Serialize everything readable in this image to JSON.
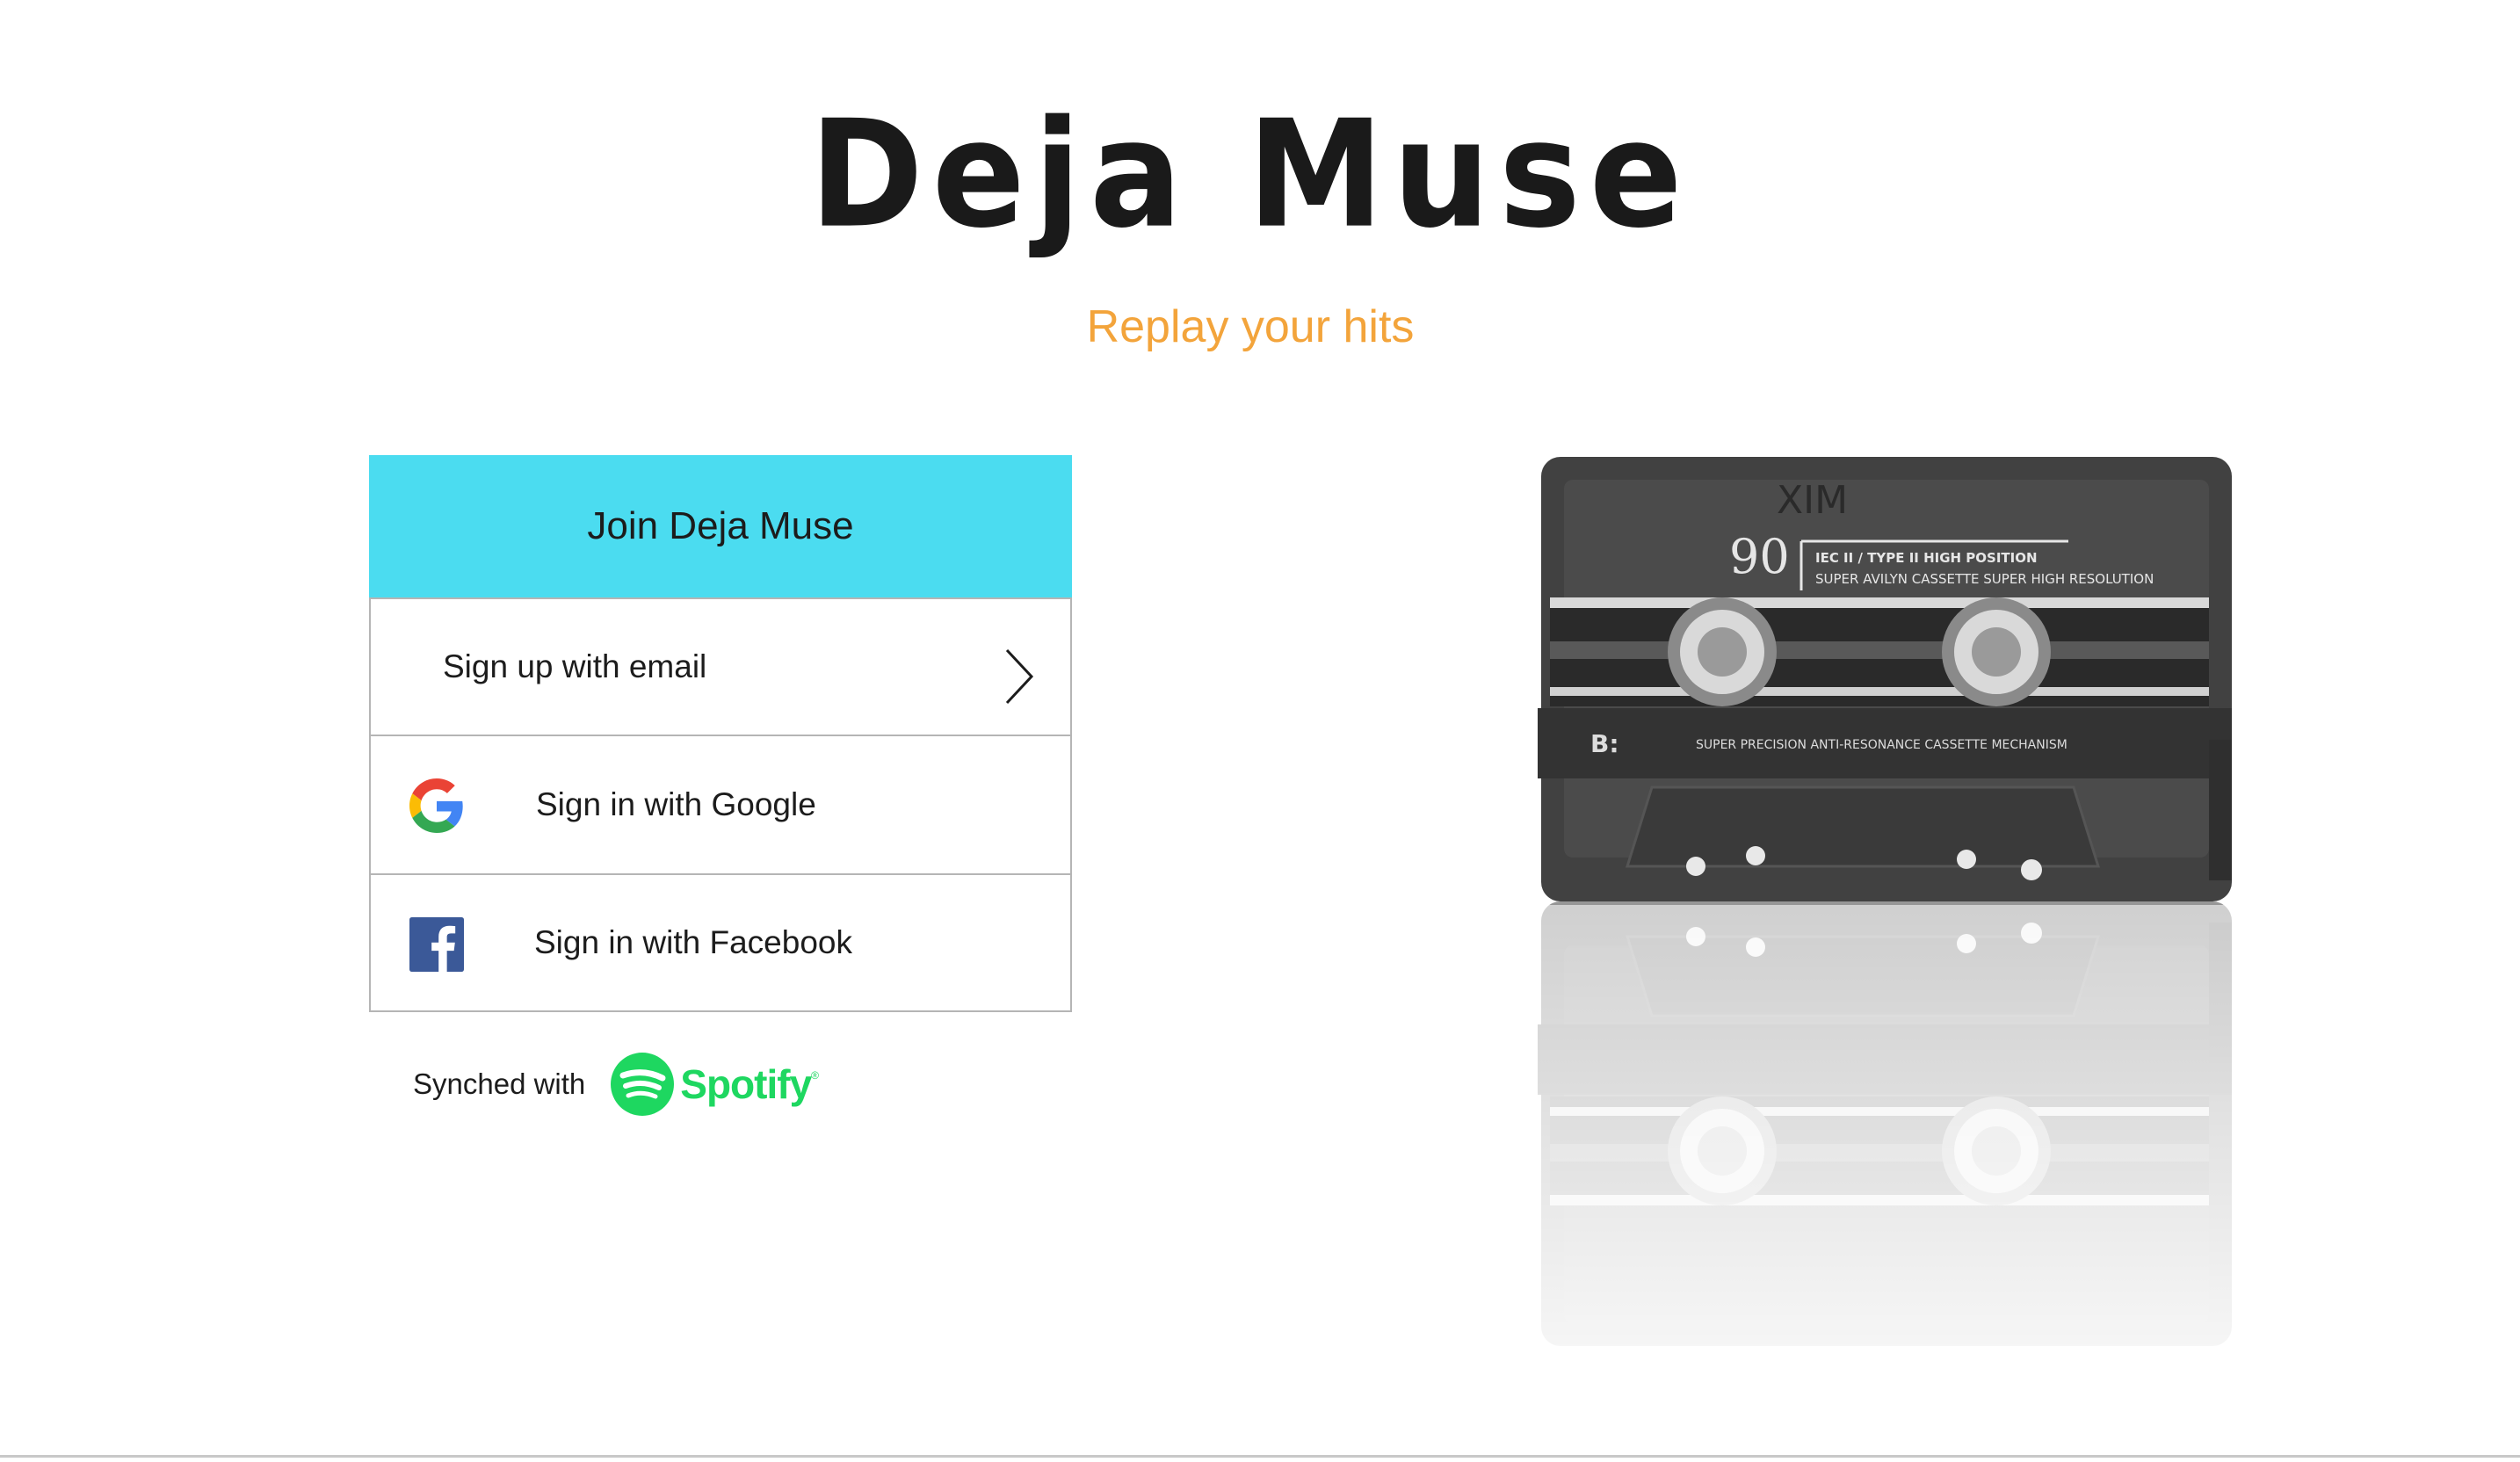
{
  "brand": {
    "title": "Deja Muse",
    "tagline": "Replay your hits"
  },
  "login_card": {
    "header": "Join Deja Muse",
    "email_label": "Sign up with email",
    "google_label": "Sign in with Google",
    "facebook_label": "Sign in with Facebook"
  },
  "sync": {
    "label": "Synched with",
    "service": "Spotify"
  },
  "cassette": {
    "label_number": "90",
    "label_line1": "IEC II / TYPE II HIGH POSITION",
    "label_line2": "SUPER AVILYN CASSETTE SUPER HIGH RESOLUTION",
    "side": "B:",
    "mechanism": "SUPER PRECISION ANTI-RESONANCE CASSETTE MECHANISM",
    "handwriting": "XIM"
  },
  "colors": {
    "header_bg": "#4bdcf0",
    "tagline": "#f3a43b",
    "spotify_green": "#1ed760",
    "facebook_blue": "#3b5998"
  }
}
